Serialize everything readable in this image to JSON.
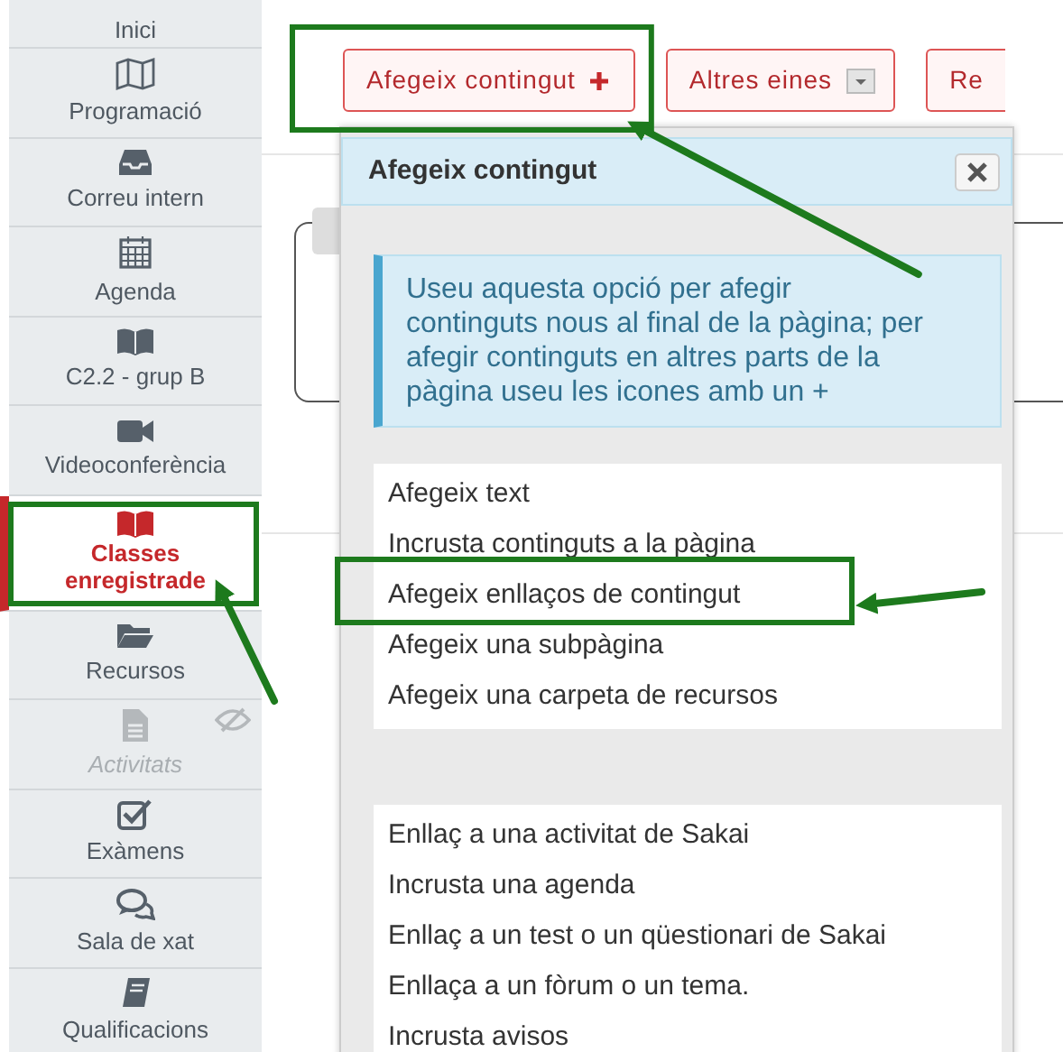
{
  "sidebar": {
    "items": [
      {
        "label": "Inici",
        "selected": false,
        "disabled": false,
        "highlighted": false
      },
      {
        "label": "Programació",
        "selected": false,
        "disabled": false,
        "highlighted": false
      },
      {
        "label": "Correu intern",
        "selected": false,
        "disabled": false,
        "highlighted": false
      },
      {
        "label": "Agenda",
        "selected": false,
        "disabled": false,
        "highlighted": false
      },
      {
        "label": "C2.2 - grup B",
        "selected": false,
        "disabled": false,
        "highlighted": false
      },
      {
        "label": "Videoconferència",
        "selected": false,
        "disabled": false,
        "highlighted": false
      },
      {
        "label": "Classes enregistrade",
        "selected": true,
        "disabled": false,
        "highlighted": true
      },
      {
        "label": "Recursos",
        "selected": false,
        "disabled": false,
        "highlighted": false
      },
      {
        "label": "Activitats",
        "selected": false,
        "disabled": true,
        "highlighted": false
      },
      {
        "label": "Exàmens",
        "selected": false,
        "disabled": false,
        "highlighted": false
      },
      {
        "label": "Sala de xat",
        "selected": false,
        "disabled": false,
        "highlighted": false
      },
      {
        "label": "Qualificacions",
        "selected": false,
        "disabled": false,
        "highlighted": false
      }
    ]
  },
  "toolbar": {
    "buttons": [
      {
        "label": "Afegeix contingut",
        "kind": "add",
        "highlighted": true
      },
      {
        "label": "Altres eines",
        "kind": "dropdown",
        "highlighted": false
      },
      {
        "label": "Re",
        "kind": "plain",
        "highlighted": false
      }
    ]
  },
  "popup": {
    "title": "Afegeix contingut",
    "info": "Useu aquesta opció per afegir continguts nous al final de la pàgina; per afegir continguts en altres parts de la pàgina useu les icones amb un +",
    "groups": [
      [
        {
          "label": "Afegeix text",
          "highlighted": false
        },
        {
          "label": "Incrusta continguts a la pàgina",
          "highlighted": false
        },
        {
          "label": "Afegeix enllaços de contingut",
          "highlighted": true
        },
        {
          "label": "Afegeix una subpàgina",
          "highlighted": false
        },
        {
          "label": "Afegeix una carpeta de recursos",
          "highlighted": false
        }
      ],
      [
        {
          "label": "Enllaç a una activitat de Sakai",
          "highlighted": false
        },
        {
          "label": "Incrusta una agenda",
          "highlighted": false
        },
        {
          "label": "Enllaç a un test o un qüestionari de Sakai",
          "highlighted": false
        },
        {
          "label": "Enllaça a un fòrum o un tema.",
          "highlighted": false
        },
        {
          "label": "Incrusta avisos",
          "highlighted": false
        }
      ]
    ]
  }
}
